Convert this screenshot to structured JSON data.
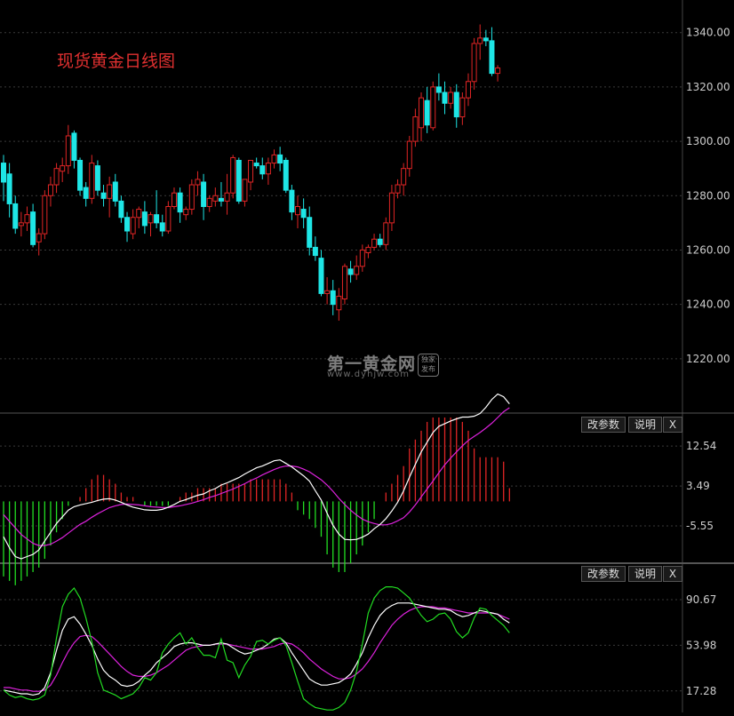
{
  "title": "现货黄金日线图",
  "watermark": {
    "main": "第一黄金网",
    "sub": "www.dyhjw.com",
    "badge": "独家发布"
  },
  "colors": {
    "up": "#e02525",
    "down": "#1ee6e6",
    "macd_up": "#e02525",
    "macd_down": "#22dd22",
    "diff": "#ffffff",
    "dea": "#dd22dd",
    "kdj_j": "#22dd22",
    "kdj_k": "#ffffff",
    "kdj_d": "#dd22dd"
  },
  "panels": [
    {
      "id": "macd",
      "buttons": [
        "改参数",
        "说明",
        "X"
      ]
    },
    {
      "id": "kdj",
      "buttons": [
        "改参数",
        "说明",
        "X"
      ]
    }
  ],
  "chart_data": [
    {
      "type": "candlestick",
      "title": "现货黄金日线图",
      "ylim": [
        1200,
        1352
      ],
      "y_ticks": [
        "1220.00",
        "1240.00",
        "1260.00",
        "1280.00",
        "1300.00",
        "1320.00",
        "1340.00"
      ],
      "candles": [
        [
          1292,
          1295,
          1278,
          1285
        ],
        [
          1288,
          1292,
          1272,
          1277
        ],
        [
          1277,
          1280,
          1266,
          1268
        ],
        [
          1269,
          1274,
          1265,
          1270
        ],
        [
          1270,
          1276,
          1267,
          1273
        ],
        [
          1274,
          1277,
          1261,
          1262
        ],
        [
          1263,
          1268,
          1258,
          1266
        ],
        [
          1266,
          1282,
          1264,
          1280
        ],
        [
          1280,
          1287,
          1276,
          1284
        ],
        [
          1284,
          1292,
          1281,
          1290
        ],
        [
          1289,
          1294,
          1285,
          1291
        ],
        [
          1291,
          1306,
          1288,
          1302
        ],
        [
          1303,
          1304,
          1290,
          1293
        ],
        [
          1293,
          1294,
          1280,
          1282
        ],
        [
          1283,
          1285,
          1276,
          1279
        ],
        [
          1279,
          1295,
          1277,
          1292
        ],
        [
          1291,
          1293,
          1280,
          1282
        ],
        [
          1281,
          1284,
          1276,
          1279
        ],
        [
          1279,
          1287,
          1272,
          1284
        ],
        [
          1285,
          1288,
          1276,
          1278
        ],
        [
          1278,
          1280,
          1270,
          1272
        ],
        [
          1272,
          1274,
          1263,
          1267
        ],
        [
          1266,
          1275,
          1264,
          1272
        ],
        [
          1272,
          1276,
          1268,
          1275
        ],
        [
          1274,
          1278,
          1266,
          1269
        ],
        [
          1270,
          1274,
          1265,
          1273
        ],
        [
          1273,
          1282,
          1268,
          1270
        ],
        [
          1270,
          1273,
          1265,
          1267
        ],
        [
          1267,
          1278,
          1266,
          1276
        ],
        [
          1276,
          1283,
          1275,
          1281
        ],
        [
          1281,
          1283,
          1270,
          1274
        ],
        [
          1273,
          1276,
          1271,
          1275
        ],
        [
          1275,
          1286,
          1273,
          1284
        ],
        [
          1284,
          1289,
          1280,
          1286
        ],
        [
          1285,
          1288,
          1271,
          1276
        ],
        [
          1276,
          1280,
          1274,
          1279
        ],
        [
          1278,
          1283,
          1276,
          1280
        ],
        [
          1279,
          1285,
          1276,
          1278
        ],
        [
          1278,
          1288,
          1273,
          1281
        ],
        [
          1281,
          1295,
          1279,
          1294
        ],
        [
          1293,
          1294,
          1277,
          1278
        ],
        [
          1278,
          1286,
          1276,
          1286
        ],
        [
          1285,
          1292,
          1282,
          1293
        ],
        [
          1292,
          1294,
          1290,
          1291
        ],
        [
          1291,
          1294,
          1286,
          1288
        ],
        [
          1288,
          1294,
          1284,
          1292
        ],
        [
          1292,
          1297,
          1290,
          1295
        ],
        [
          1295,
          1298,
          1289,
          1292
        ],
        [
          1293,
          1294,
          1281,
          1282
        ],
        [
          1282,
          1284,
          1271,
          1274
        ],
        [
          1273,
          1280,
          1268,
          1276
        ],
        [
          1275,
          1279,
          1268,
          1272
        ],
        [
          1272,
          1276,
          1258,
          1261
        ],
        [
          1261,
          1265,
          1256,
          1258
        ],
        [
          1257,
          1260,
          1243,
          1244
        ],
        [
          1244,
          1250,
          1240,
          1245
        ],
        [
          1245,
          1249,
          1236,
          1240
        ],
        [
          1238,
          1246,
          1234,
          1243
        ],
        [
          1242,
          1255,
          1240,
          1254
        ],
        [
          1253,
          1256,
          1248,
          1251
        ],
        [
          1251,
          1258,
          1249,
          1254
        ],
        [
          1254,
          1262,
          1252,
          1260
        ],
        [
          1259,
          1262,
          1257,
          1261
        ],
        [
          1261,
          1266,
          1260,
          1264
        ],
        [
          1264,
          1266,
          1261,
          1262
        ],
        [
          1262,
          1272,
          1260,
          1270
        ],
        [
          1270,
          1284,
          1267,
          1281
        ],
        [
          1281,
          1286,
          1279,
          1284
        ],
        [
          1284,
          1292,
          1280,
          1290
        ],
        [
          1290,
          1302,
          1287,
          1300
        ],
        [
          1300,
          1312,
          1298,
          1309
        ],
        [
          1305,
          1318,
          1300,
          1316
        ],
        [
          1315,
          1320,
          1303,
          1306
        ],
        [
          1305,
          1322,
          1304,
          1320
        ],
        [
          1320,
          1325,
          1315,
          1318
        ],
        [
          1318,
          1322,
          1310,
          1314
        ],
        [
          1314,
          1320,
          1312,
          1318
        ],
        [
          1318,
          1321,
          1305,
          1309
        ],
        [
          1309,
          1318,
          1306,
          1316
        ],
        [
          1316,
          1325,
          1313,
          1322
        ],
        [
          1322,
          1338,
          1319,
          1336
        ],
        [
          1336,
          1343,
          1330,
          1338
        ],
        [
          1338,
          1341,
          1335,
          1337
        ],
        [
          1337,
          1342,
          1324,
          1325
        ],
        [
          1325,
          1328,
          1322,
          1327
        ]
      ]
    },
    {
      "type": "bar_line",
      "name": "MACD",
      "y_ticks": [
        "12.54",
        "3.49",
        "-5.55"
      ],
      "ylim": [
        -14,
        20
      ],
      "diff": [
        -8,
        -10.5,
        -12.5,
        -13,
        -12.5,
        -12,
        -11,
        -9,
        -7,
        -5,
        -3.5,
        -2,
        -1.2,
        -0.8,
        -0.5,
        -0.2,
        0.2,
        0.5,
        0.6,
        0.3,
        -0.2,
        -0.8,
        -1.3,
        -1.6,
        -1.9,
        -2,
        -2,
        -1.8,
        -1.3,
        -0.7,
        0,
        0.4,
        0.9,
        1.4,
        1.7,
        2.4,
        2.9,
        3.7,
        4.2,
        4.8,
        5.4,
        6.2,
        6.9,
        7.6,
        8,
        8.6,
        9.2,
        9.4,
        8.6,
        7.8,
        6.8,
        5.8,
        4.6,
        2.4,
        0.3,
        -2.7,
        -5.4,
        -7.4,
        -8.6,
        -8.7,
        -8.6,
        -8.1,
        -7.4,
        -6.2,
        -5.2,
        -3.9,
        -2.2,
        -0.2,
        2.4,
        5.5,
        8.4,
        11.2,
        13.4,
        15.6,
        17,
        17.6,
        18.2,
        18.7,
        19.1,
        19.1,
        19.3,
        19.9,
        21.3,
        23.1,
        24.3,
        23.7,
        22.1
      ],
      "dea": [
        -3,
        -4.5,
        -6,
        -7.5,
        -8.5,
        -9.5,
        -10,
        -10,
        -9.7,
        -9,
        -8.2,
        -7.2,
        -6.2,
        -5.2,
        -4.5,
        -3.6,
        -2.8,
        -2.1,
        -1.4,
        -1,
        -0.7,
        -0.6,
        -0.7,
        -0.8,
        -1,
        -1.2,
        -1.3,
        -1.4,
        -1.4,
        -1.2,
        -1,
        -0.7,
        -0.4,
        0,
        0.4,
        0.9,
        1.3,
        1.8,
        2.3,
        2.8,
        3.4,
        4,
        4.7,
        5.3,
        6,
        6.6,
        7.2,
        7.7,
        8,
        8,
        7.8,
        7.3,
        6.7,
        5.8,
        4.9,
        3.7,
        2.3,
        0.7,
        -0.7,
        -2,
        -3.1,
        -4,
        -4.6,
        -5,
        -5.3,
        -5.3,
        -5,
        -4.4,
        -3.7,
        -2.4,
        -0.8,
        1,
        2.8,
        4.6,
        6.5,
        8.3,
        9.8,
        11.2,
        12.6,
        13.8,
        14.7,
        15.6,
        16.6,
        17.7,
        19,
        20.3,
        21.2
      ],
      "hist": [
        -17,
        -18,
        -19,
        -18,
        -17,
        -16,
        -15,
        -13,
        -10,
        -7,
        -4,
        -1,
        0,
        1,
        3,
        5,
        6,
        6,
        5,
        4,
        2,
        1,
        1,
        0,
        -1,
        -1,
        -1,
        -1,
        -1,
        0,
        1,
        2,
        2,
        3,
        3,
        3,
        3,
        4,
        4,
        4,
        4,
        4,
        5,
        5,
        5,
        5,
        5,
        5,
        4,
        2,
        -2,
        -3,
        -4,
        -6,
        -8,
        -12,
        -15,
        -16,
        -16,
        -14,
        -12,
        -10,
        -7,
        -4,
        0,
        2,
        4,
        6,
        8,
        12,
        14,
        16,
        18,
        19,
        19,
        19,
        19,
        19,
        18,
        16,
        12,
        10,
        10,
        10,
        10,
        9,
        3
      ]
    },
    {
      "type": "line",
      "name": "KDJ",
      "y_ticks": [
        "90.67",
        "53.98",
        "17.28"
      ],
      "ylim": [
        0,
        120
      ],
      "j": [
        18,
        14,
        12,
        13,
        11,
        10,
        11,
        14,
        30,
        60,
        85,
        95,
        100,
        92,
        76,
        57,
        32,
        18,
        16,
        14,
        11,
        13,
        15,
        20,
        28,
        26,
        32,
        48,
        55,
        60,
        64,
        55,
        60,
        52,
        46,
        46,
        44,
        59,
        42,
        40,
        28,
        38,
        45,
        57,
        58,
        55,
        58,
        60,
        54,
        40,
        25,
        11,
        7,
        4,
        3,
        2,
        2,
        4,
        8,
        18,
        33,
        55,
        80,
        92,
        98,
        101,
        101,
        100,
        96,
        92,
        85,
        78,
        73,
        75,
        79,
        80,
        75,
        65,
        60,
        64,
        76,
        84,
        83,
        78,
        74,
        70,
        64
      ],
      "k": [
        18,
        17,
        16,
        15,
        15,
        14,
        15,
        20,
        32,
        50,
        66,
        75,
        77,
        71,
        63,
        54,
        43,
        34,
        29,
        26,
        22,
        21,
        22,
        25,
        30,
        34,
        40,
        44,
        48,
        53,
        55,
        56,
        56,
        55,
        54,
        54,
        55,
        56,
        55,
        52,
        49,
        47,
        48,
        50,
        52,
        55,
        59,
        60,
        56,
        48,
        41,
        34,
        27,
        24,
        22,
        22,
        23,
        24,
        27,
        31,
        39,
        48,
        60,
        70,
        78,
        83,
        86,
        88,
        88,
        88,
        87,
        86,
        85,
        84,
        83,
        83,
        82,
        79,
        77,
        78,
        80,
        82,
        81,
        80,
        79,
        75,
        72
      ],
      "d": [
        20,
        20,
        19,
        18,
        18,
        17,
        17,
        18,
        22,
        30,
        40,
        49,
        56,
        61,
        62,
        61,
        57,
        52,
        47,
        42,
        37,
        33,
        30,
        29,
        29,
        30,
        32,
        35,
        38,
        42,
        46,
        50,
        52,
        53,
        54,
        54,
        55,
        55,
        55,
        54,
        53,
        52,
        51,
        51,
        51,
        52,
        53,
        55,
        56,
        55,
        52,
        48,
        43,
        39,
        35,
        32,
        29,
        27,
        27,
        28,
        31,
        35,
        41,
        48,
        56,
        63,
        70,
        75,
        79,
        82,
        84,
        85,
        85,
        85,
        84,
        84,
        83,
        82,
        81,
        80,
        80,
        80,
        80,
        80,
        79,
        77,
        75
      ]
    }
  ]
}
